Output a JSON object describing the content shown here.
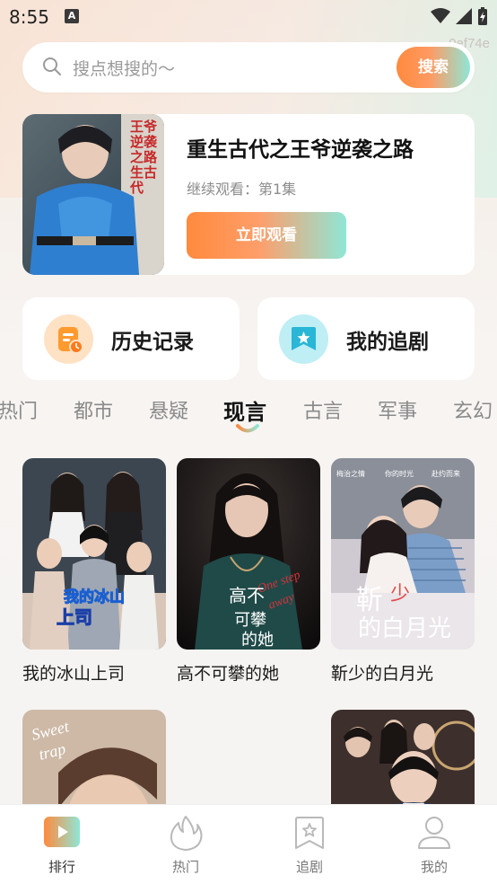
{
  "status_bar": {
    "time": "8:55",
    "notification_letter": "A"
  },
  "watermark": "0ef74e",
  "search": {
    "placeholder": "搜点想搜的～",
    "button_label": "搜索"
  },
  "continue_watching": {
    "title": "重生古代之王爷逆袭之路",
    "progress": "继续观看：第1集",
    "button_label": "立即观看",
    "poster_overlay_text": "王爷逆袭之路 生古代"
  },
  "quick_links": {
    "history": {
      "label": "历史记录",
      "icon": "history-record-icon"
    },
    "follow": {
      "label": "我的追剧",
      "icon": "bookmark-star-icon"
    }
  },
  "tabs": [
    {
      "label": "热门",
      "active": false
    },
    {
      "label": "都市",
      "active": false
    },
    {
      "label": "悬疑",
      "active": false
    },
    {
      "label": "现言",
      "active": true
    },
    {
      "label": "古言",
      "active": false
    },
    {
      "label": "军事",
      "active": false
    },
    {
      "label": "玄幻",
      "active": false
    }
  ],
  "dramas": [
    {
      "title": "我的冰山上司",
      "poster_text": "我的冰山上司"
    },
    {
      "title": "高不可攀的她",
      "poster_text": "高不可攀的她"
    },
    {
      "title": "靳少的白月光",
      "poster_text": "靳少的白月光"
    },
    {
      "title": "",
      "poster_text": "Sweet trap"
    },
    {
      "title": "",
      "poster_text": ""
    }
  ],
  "bottom_nav": [
    {
      "label": "排行",
      "icon": "play-ranking-icon",
      "active": true
    },
    {
      "label": "热门",
      "icon": "flame-icon",
      "active": false
    },
    {
      "label": "追剧",
      "icon": "bookmark-star-icon",
      "active": false
    },
    {
      "label": "我的",
      "icon": "user-icon",
      "active": false
    }
  ],
  "colors": {
    "accent_orange": "#ff8a3d",
    "accent_mint": "#8fe6d6",
    "history_icon_bg": "#ffe1c4",
    "follow_icon_bg": "#bfeef5"
  }
}
